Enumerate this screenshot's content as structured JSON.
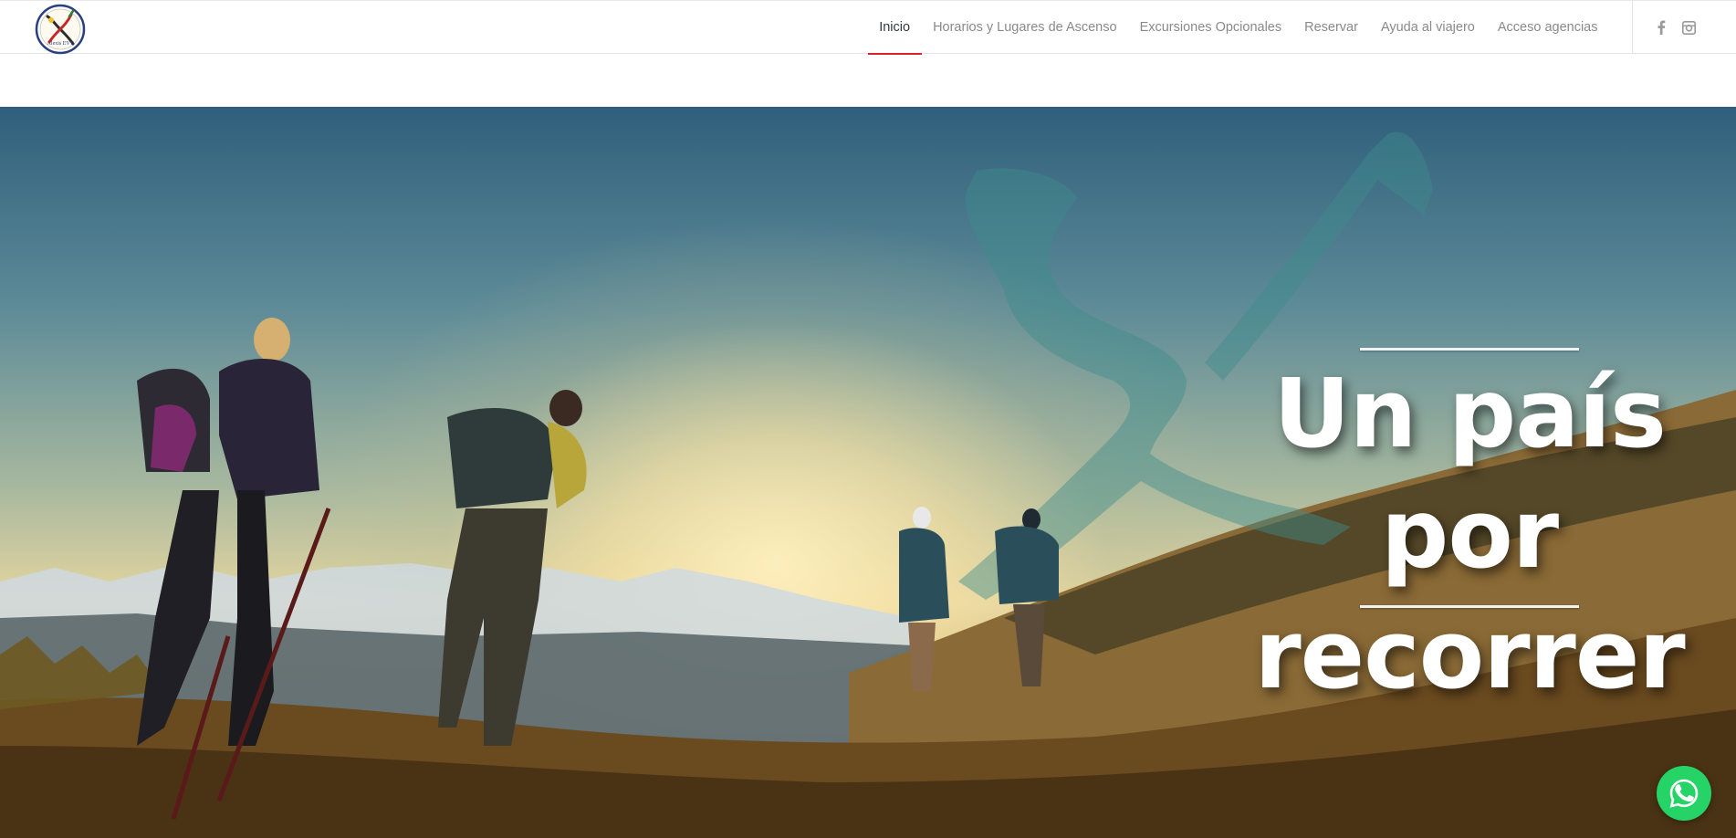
{
  "header": {
    "logo_text": "Alexis EVT",
    "nav": [
      {
        "label": "Inicio",
        "active": true
      },
      {
        "label": "Horarios y Lugares de Ascenso",
        "active": false
      },
      {
        "label": "Excursiones Opcionales",
        "active": false
      },
      {
        "label": "Reservar",
        "active": false
      },
      {
        "label": "Ayuda al viajero",
        "active": false
      },
      {
        "label": "Acceso agencias",
        "active": false
      }
    ],
    "social": [
      "facebook-icon",
      "instagram-icon"
    ]
  },
  "hero": {
    "title_line1": "Un país por",
    "title_line2": "recorrer"
  },
  "colors": {
    "accent": "#d8222d",
    "whatsapp": "#25d366",
    "nav_text": "#8a8a8a",
    "nav_active": "#2f3a44"
  },
  "floating": {
    "whatsapp_icon": "whatsapp-icon"
  }
}
